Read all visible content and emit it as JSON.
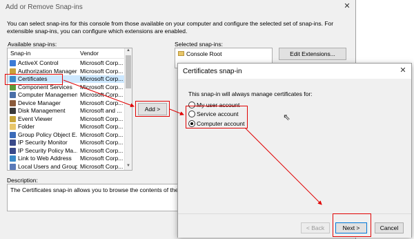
{
  "outer_dialog": {
    "title": "Add or Remove Snap-ins",
    "close": "✕",
    "intro": "You can select snap-ins for this console from those available on your computer and configure the selected set of snap-ins. For extensible snap-ins, you can configure which extensions are enabled.",
    "available_label": "Available snap-ins:",
    "columns": [
      "Snap-in",
      "Vendor"
    ],
    "snapins": [
      {
        "name": "ActiveX Control",
        "vendor": "Microsoft Corp...",
        "icon_color": "#3c7bd6"
      },
      {
        "name": "Authorization Manager",
        "vendor": "Microsoft Corp...",
        "icon_color": "#c9a23a"
      },
      {
        "name": "Certificates",
        "vendor": "Microsoft Corp...",
        "icon_color": "#3c89c8"
      },
      {
        "name": "Component Services",
        "vendor": "Microsoft Corp...",
        "icon_color": "#5a9b3a"
      },
      {
        "name": "Computer Management",
        "vendor": "Microsoft Corp...",
        "icon_color": "#4a6fa8"
      },
      {
        "name": "Device Manager",
        "vendor": "Microsoft Corp...",
        "icon_color": "#8a5a3a"
      },
      {
        "name": "Disk Management",
        "vendor": "Microsoft and ...",
        "icon_color": "#3a3a3a"
      },
      {
        "name": "Event Viewer",
        "vendor": "Microsoft Corp...",
        "icon_color": "#c8a63a"
      },
      {
        "name": "Folder",
        "vendor": "Microsoft Corp...",
        "icon_color": "#e8c66a"
      },
      {
        "name": "Group Policy Object E...",
        "vendor": "Microsoft Corp...",
        "icon_color": "#3a6ab8"
      },
      {
        "name": "IP Security Monitor",
        "vendor": "Microsoft Corp...",
        "icon_color": "#3a4a8a"
      },
      {
        "name": "IP Security Policy Ma...",
        "vendor": "Microsoft Corp...",
        "icon_color": "#3a4a8a"
      },
      {
        "name": "Link to Web Address",
        "vendor": "Microsoft Corp...",
        "icon_color": "#3a8ac8"
      },
      {
        "name": "Local Users and Groups",
        "vendor": "Microsoft Corp...",
        "icon_color": "#5a7ab8"
      }
    ],
    "selected_index": 2,
    "add_button": "Add >",
    "selected_label": "Selected snap-ins:",
    "selected_items": [
      "Console Root"
    ],
    "edit_extensions_button": "Edit Extensions...",
    "description_label": "Description:",
    "description_text": "The Certificates snap-in allows you to browse the contents of the ce"
  },
  "inner_dialog": {
    "title": "Certificates snap-in",
    "close": "✕",
    "prompt": "This snap-in will always manage certificates for:",
    "options": [
      {
        "label": "My user account",
        "checked": false
      },
      {
        "label": "Service account",
        "checked": false
      },
      {
        "label": "Computer account",
        "checked": true
      }
    ],
    "back_button": "< Back",
    "next_button": "Next >",
    "cancel_button": "Cancel"
  },
  "annotation_color": "#e00000"
}
